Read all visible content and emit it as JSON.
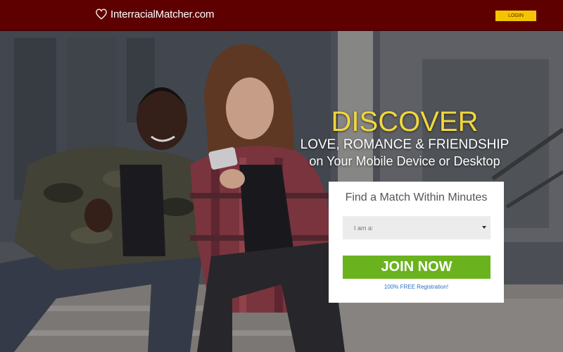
{
  "header": {
    "logo_text": "InterracialMatcher.com",
    "logo_icon": "heart-icon",
    "login_label": "LOGIN"
  },
  "hero": {
    "headline_big": "DISCOVER",
    "headline_line1": "LOVE, ROMANCE & FRIENDSHIP",
    "headline_line2": "on Your Mobile Device or Desktop",
    "photo": "couple-sitting-on-steps-photo"
  },
  "signup": {
    "title": "Find a Match Within Minutes",
    "select_value": "I am a:",
    "join_label": "JOIN NOW",
    "free_note": "100% FREE Registration!"
  },
  "colors": {
    "header_bg": "#5e0000",
    "login_bg": "#f5c400",
    "headline_accent": "#f2d63c",
    "join_bg": "#6ab31f",
    "link_blue": "#2a6fc1"
  }
}
